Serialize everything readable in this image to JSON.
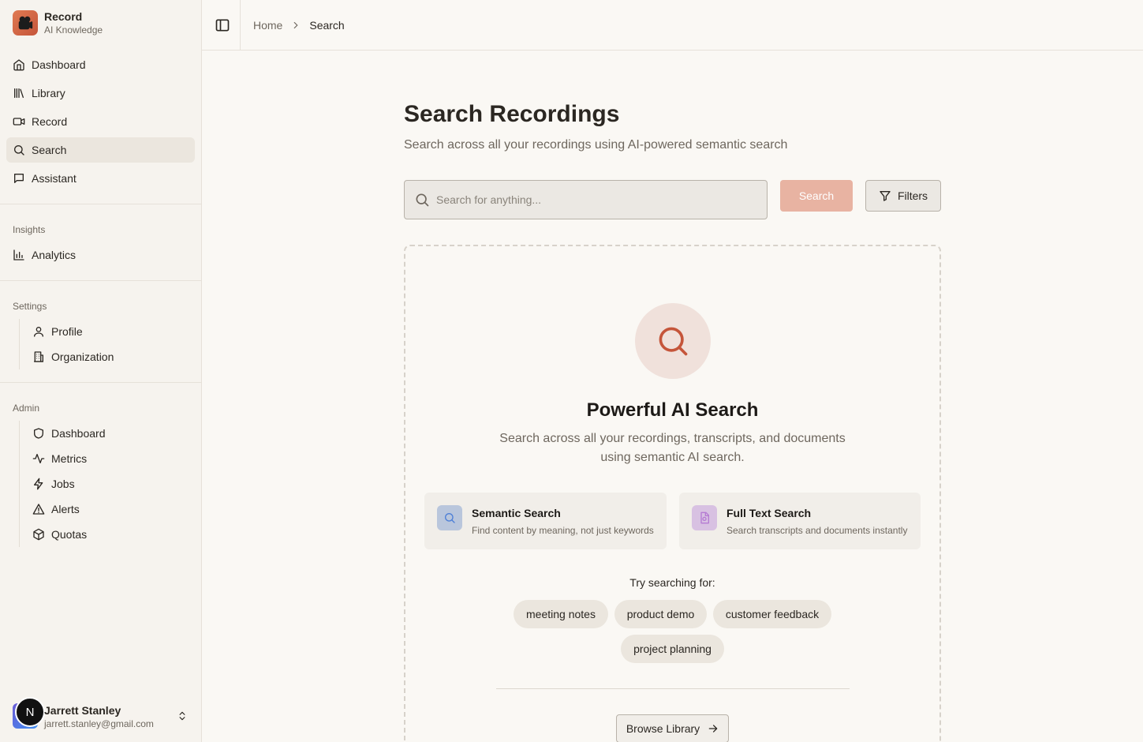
{
  "brand": {
    "name": "Record",
    "subtitle": "AI Knowledge"
  },
  "nav": {
    "items": [
      {
        "label": "Dashboard",
        "icon": "home-icon"
      },
      {
        "label": "Library",
        "icon": "library-icon"
      },
      {
        "label": "Record",
        "icon": "video-icon"
      },
      {
        "label": "Search",
        "icon": "search-icon",
        "active": true
      },
      {
        "label": "Assistant",
        "icon": "message-icon"
      }
    ],
    "insights_label": "Insights",
    "insights": [
      {
        "label": "Analytics",
        "icon": "bar-chart-icon"
      }
    ],
    "settings_label": "Settings",
    "settings": [
      {
        "label": "Profile",
        "icon": "user-icon"
      },
      {
        "label": "Organization",
        "icon": "building-icon"
      }
    ],
    "admin_label": "Admin",
    "admin": [
      {
        "label": "Dashboard",
        "icon": "shield-icon"
      },
      {
        "label": "Metrics",
        "icon": "activity-icon"
      },
      {
        "label": "Jobs",
        "icon": "zap-icon"
      },
      {
        "label": "Alerts",
        "icon": "alert-triangle-icon"
      },
      {
        "label": "Quotas",
        "icon": "package-icon"
      }
    ]
  },
  "user": {
    "initial": "N",
    "name": "Jarrett Stanley",
    "email": "jarrett.stanley@gmail.com"
  },
  "breadcrumb": {
    "home": "Home",
    "current": "Search"
  },
  "page": {
    "title": "Search Recordings",
    "subtitle": "Search across all your recordings using AI-powered semantic search"
  },
  "search": {
    "placeholder": "Search for anything...",
    "button_label": "Search",
    "filters_label": "Filters"
  },
  "empty_state": {
    "title": "Powerful AI Search",
    "description": "Search across all your recordings, transcripts, and documents using semantic AI search.",
    "features": [
      {
        "title": "Semantic Search",
        "description": "Find content by meaning, not just keywords"
      },
      {
        "title": "Full Text Search",
        "description": "Search transcripts and documents instantly"
      }
    ],
    "try_label": "Try searching for:",
    "suggestions": [
      "meeting notes",
      "product demo",
      "customer feedback",
      "project planning"
    ],
    "browse_label": "Browse Library"
  },
  "colors": {
    "accent": "#c5553a",
    "search_button": "#e8b3a2",
    "active_nav": "#ebe6de"
  }
}
